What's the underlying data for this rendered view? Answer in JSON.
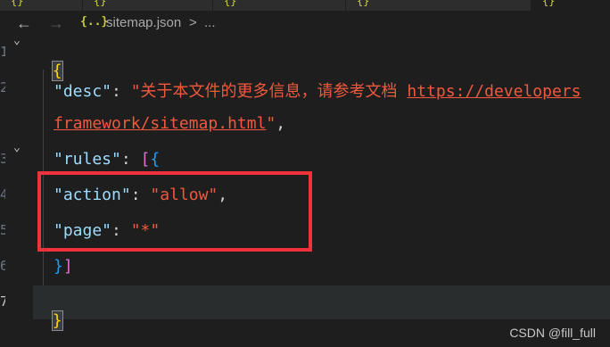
{
  "breadcrumb": {
    "back": "←",
    "forward": "→",
    "icon": "{..}",
    "file": "sitemap.json",
    "separator": ">",
    "more": "..."
  },
  "gutter": {
    "line_numbers": [
      "1",
      "2",
      "3",
      "4",
      "5",
      "6",
      "7"
    ],
    "fold_marker": "⌄"
  },
  "editor": {
    "line1": {
      "brace": "{"
    },
    "line2": {
      "key": "\"desc\"",
      "colon": ": ",
      "value": "\"关于本文件的更多信息，请参考文档 ",
      "url_start": "https://developers",
      "url_cont": "framework/sitemap.html",
      "value_end": "\"",
      "comma": ","
    },
    "line3": {
      "key": "\"rules\"",
      "colon": ": ",
      "bracket": "[",
      "brace": "{"
    },
    "line4": {
      "key": "\"action\"",
      "colon": ": ",
      "value": "\"allow\"",
      "comma": ","
    },
    "line5": {
      "key": "\"page\"",
      "colon": ": ",
      "value": "\"*\""
    },
    "line6": {
      "brace": "}",
      "bracket": "]"
    },
    "line7": {
      "brace": "}"
    }
  },
  "watermark": "CSDN @fill_full",
  "colors": {
    "background": "#1e1e1e",
    "key": "#9cdcfe",
    "string": "#f0593e",
    "brace": "#ffd700",
    "bracket": "#da70d6",
    "highlight_box": "#f0323a"
  }
}
